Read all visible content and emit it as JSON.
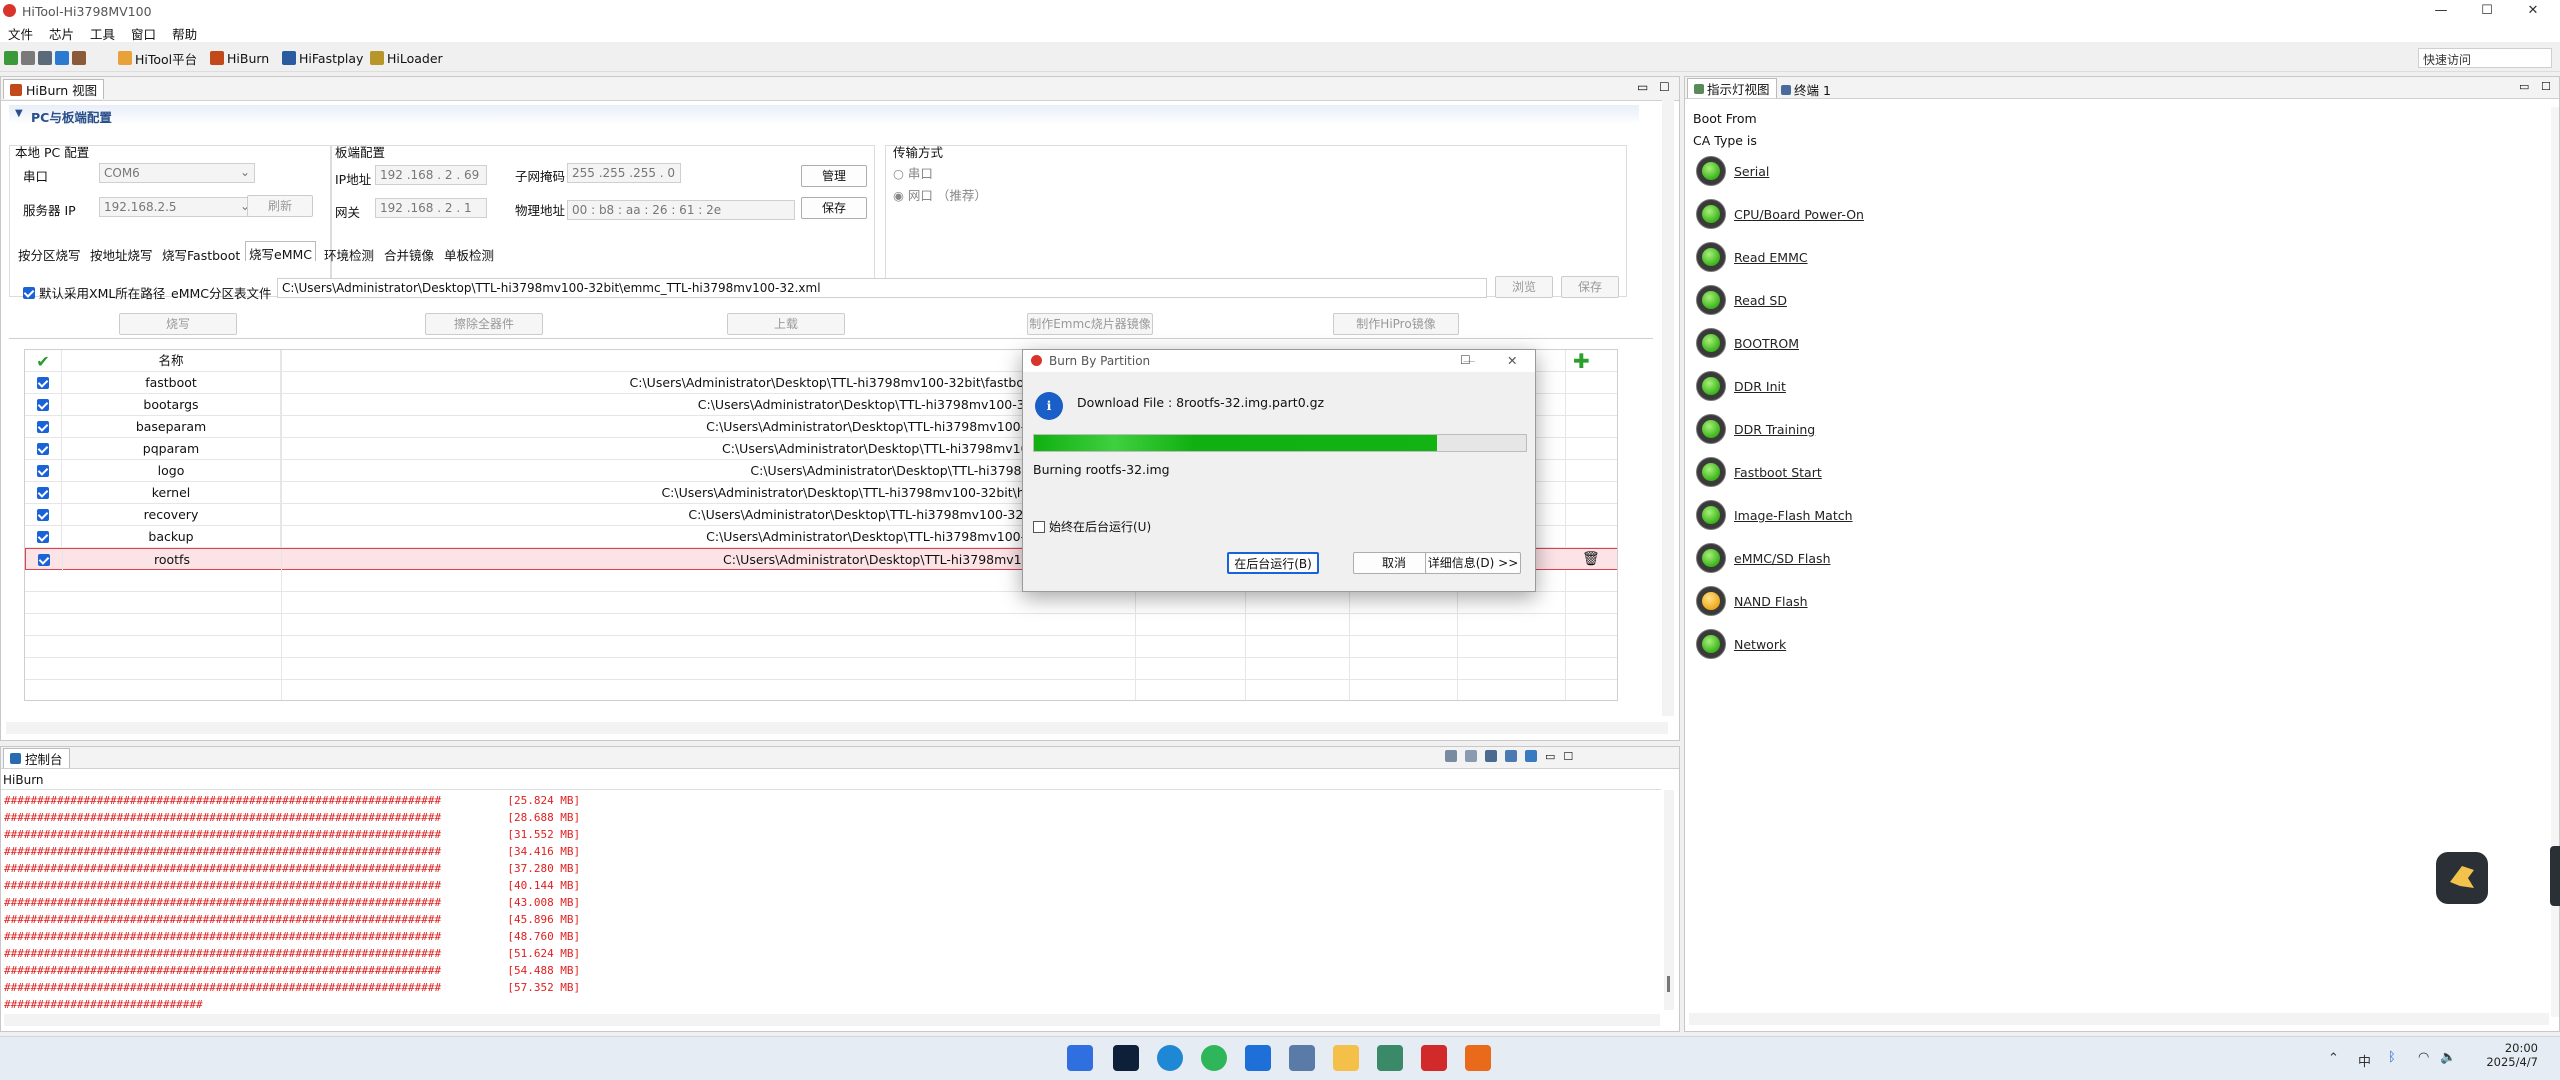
{
  "window": {
    "title": "HiTool-Hi3798MV100",
    "min": "—",
    "max": "☐",
    "close": "✕"
  },
  "menu": [
    "文件",
    "芯片",
    "工具",
    "窗口",
    "帮助"
  ],
  "toolbar": {
    "items": [
      "HiTool平台",
      "HiBurn",
      "HiFastplay",
      "HiLoader"
    ],
    "quick_access": "快速访问"
  },
  "main_tab": "HiBurn 视图",
  "section": "PC与板端配置",
  "local_pc": {
    "legend": "本地 PC 配置",
    "serial_label": "串口",
    "serial_value": "COM6",
    "server_ip_label": "服务器 IP",
    "server_ip_value": "192.168.2.5",
    "refresh": "刷新"
  },
  "board": {
    "legend": "板端配置",
    "ip_label": "IP地址",
    "ip_value": "192 .168 . 2 . 69",
    "mask_label": "子网掩码",
    "mask_value": "255 .255 .255 . 0",
    "gw_label": "网关",
    "gw_value": "192 .168 . 2 . 1",
    "mac_label": "物理地址",
    "mac_value": "00 : b8 : aa : 26 : 61 : 2e",
    "manage": "管理",
    "save": "保存"
  },
  "transfer": {
    "legend": "传输方式",
    "serial": "串口",
    "net": "网口 （推荐）"
  },
  "subtabs": [
    "按分区烧写",
    "按地址烧写",
    "烧写Fastboot",
    "烧写eMMC",
    "环境检测",
    "合并镜像",
    "单板检测"
  ],
  "emmc": {
    "default_xml": "默认采用XML所在路径",
    "table_label": "eMMC分区表文件",
    "table_path": "C:\\Users\\Administrator\\Desktop\\TTL-hi3798mv100-32bit\\emmc_TTL-hi3798mv100-32.xml",
    "browse": "浏览",
    "save": "保存",
    "burn": "烧写",
    "erase_all": "擦除全器件",
    "upload": "上载",
    "make_emmc": "制作Emmc烧片器镜像",
    "make_hipro": "制作HiPro镜像"
  },
  "table": {
    "header_name": "名称",
    "rows": [
      {
        "name": "fastboot",
        "path": "C:\\Users\\Administrator\\Desktop\\TTL-hi3798mv100-32bit\\fastboot-h"
      },
      {
        "name": "bootargs",
        "path": "C:\\Users\\Administrator\\Desktop\\TTL-hi3798mv100-32bit"
      },
      {
        "name": "baseparam",
        "path": "C:\\Users\\Administrator\\Desktop\\TTL-hi3798mv100-32b"
      },
      {
        "name": "pqparam",
        "path": "C:\\Users\\Administrator\\Desktop\\TTL-hi3798mv100-3"
      },
      {
        "name": "logo",
        "path": "C:\\Users\\Administrator\\Desktop\\TTL-hi3798mv1"
      },
      {
        "name": "kernel",
        "path": "C:\\Users\\Administrator\\Desktop\\TTL-hi3798mv100-32bit\\hi_ke"
      },
      {
        "name": "recovery",
        "path": "C:\\Users\\Administrator\\Desktop\\TTL-hi3798mv100-32bit\\r"
      },
      {
        "name": "backup",
        "path": "C:\\Users\\Administrator\\Desktop\\TTL-hi3798mv100-32b"
      },
      {
        "name": "rootfs",
        "path": "C:\\Users\\Administrator\\Desktop\\TTL-hi3798mv100-3"
      }
    ]
  },
  "console": {
    "tab": "控制台",
    "source": "HiBurn",
    "lines": [
      {
        "bar": "##################################################################",
        "mb": "[25.824 MB]"
      },
      {
        "bar": "##################################################################",
        "mb": "[28.688 MB]"
      },
      {
        "bar": "##################################################################",
        "mb": "[31.552 MB]"
      },
      {
        "bar": "##################################################################",
        "mb": "[34.416 MB]"
      },
      {
        "bar": "##################################################################",
        "mb": "[37.280 MB]"
      },
      {
        "bar": "##################################################################",
        "mb": "[40.144 MB]"
      },
      {
        "bar": "##################################################################",
        "mb": "[43.008 MB]"
      },
      {
        "bar": "##################################################################",
        "mb": "[45.896 MB]"
      },
      {
        "bar": "##################################################################",
        "mb": "[48.760 MB]"
      },
      {
        "bar": "##################################################################",
        "mb": "[51.624 MB]"
      },
      {
        "bar": "##################################################################",
        "mb": "[54.488 MB]"
      },
      {
        "bar": "##################################################################",
        "mb": "[57.352 MB]"
      }
    ],
    "last": "##############################"
  },
  "right_panel": {
    "tabs": [
      "指示灯视图",
      "终端 1"
    ],
    "boot_from": "Boot From",
    "ca_type": "CA Type is",
    "leds": [
      {
        "label": "Serial",
        "state": "green"
      },
      {
        "label": "CPU/Board Power-On",
        "state": "green"
      },
      {
        "label": "Read EMMC",
        "state": "green"
      },
      {
        "label": "Read SD",
        "state": "green"
      },
      {
        "label": "BOOTROM",
        "state": "green"
      },
      {
        "label": "DDR Init",
        "state": "green"
      },
      {
        "label": "DDR Training",
        "state": "green"
      },
      {
        "label": "Fastboot Start",
        "state": "green"
      },
      {
        "label": "Image-Flash Match",
        "state": "green"
      },
      {
        "label": "eMMC/SD Flash",
        "state": "green"
      },
      {
        "label": "NAND Flash",
        "state": "amber"
      },
      {
        "label": "Network",
        "state": "green"
      }
    ]
  },
  "dialog": {
    "title": "Burn By Partition",
    "download_file": "Download File : 8rootfs-32.img.part0.gz",
    "progress": 0.82,
    "status": "Burning rootfs-32.img",
    "always_bg": "始终在后台运行(U)",
    "run_bg": "在后台运行(B)",
    "cancel": "取消",
    "details": "详细信息(D) >>"
  },
  "clock": {
    "time": "20:00",
    "date": "2025/4/7"
  },
  "colors": {
    "accent": "#1a62d8",
    "progress": "#12b312",
    "console_text": "#e02020",
    "selected_row": "#fbe3e6"
  }
}
